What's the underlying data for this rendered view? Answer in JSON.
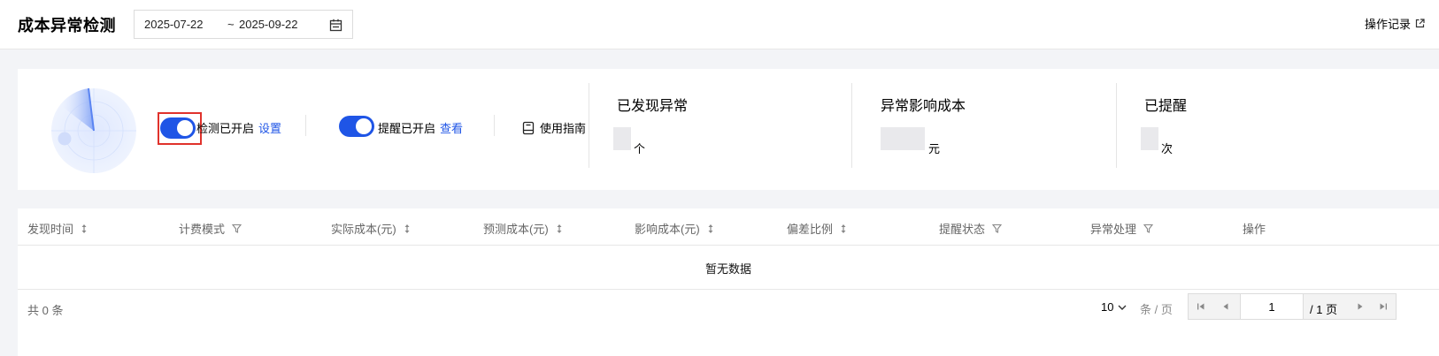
{
  "header": {
    "title": "成本异常检测",
    "date_start": "2025-07-22",
    "date_sep": "~",
    "date_end": "2025-09-22",
    "op_record": "操作记录"
  },
  "overview": {
    "detection_label": "检测已开启",
    "detection_on": true,
    "settings_link": "设置",
    "reminder_label": "提醒已开启",
    "reminder_on": true,
    "view_link": "查看",
    "guide": "使用指南",
    "stats": [
      {
        "label": "已发现异常",
        "unit": "个"
      },
      {
        "label": "异常影响成本",
        "unit": "元"
      },
      {
        "label": "已提醒",
        "unit": "次"
      }
    ]
  },
  "table": {
    "columns": [
      {
        "label": "发现时间",
        "control": "sort"
      },
      {
        "label": "计费模式",
        "control": "filter"
      },
      {
        "label": "实际成本(元)",
        "control": "sort"
      },
      {
        "label": "预测成本(元)",
        "control": "sort"
      },
      {
        "label": "影响成本(元)",
        "control": "sort"
      },
      {
        "label": "偏差比例",
        "control": "sort"
      },
      {
        "label": "提醒状态",
        "control": "filter"
      },
      {
        "label": "异常处理",
        "control": "filter"
      },
      {
        "label": "操作",
        "control": "none"
      }
    ],
    "empty_text": "暂无数据"
  },
  "pagination": {
    "total": "共 0 条",
    "page_size": "10",
    "per_page": "条 / 页",
    "current_page": "1",
    "total_pages": "/ 1 页"
  },
  "colors": {
    "accent": "#1f55e6",
    "highlight": "#e0322c",
    "background": "#f3f4f7"
  }
}
